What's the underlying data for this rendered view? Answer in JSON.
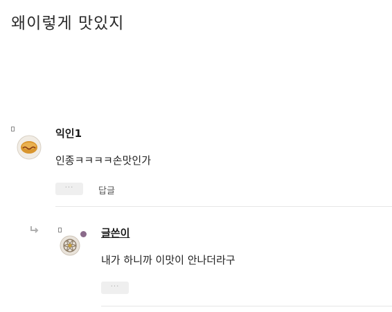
{
  "post": {
    "body": "왜이렇게 맛있지"
  },
  "comments": [
    {
      "nickname": "익인1",
      "text": "인종ㅋㅋㅋㅋ손맛인가",
      "more_label": "···",
      "reply_label": "답글"
    },
    {
      "nickname": "글쓴이",
      "text": "내가 하니까 이맛이 안나더라구",
      "more_label": "···"
    }
  ],
  "colors": {
    "text": "#222222",
    "divider": "#e6e6e6",
    "button_bg": "#efefef"
  }
}
